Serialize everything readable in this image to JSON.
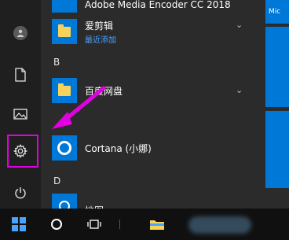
{
  "applist": {
    "items": [
      {
        "label": "Adobe Media Encoder CC 2018"
      },
      {
        "label": "爱剪辑",
        "sub": "最近添加"
      },
      {
        "letter": "B"
      },
      {
        "label": "百度网盘"
      },
      {
        "label": "Cortana (小娜)"
      },
      {
        "letter": "D"
      },
      {
        "label": "地图"
      }
    ]
  },
  "tiles": {
    "top_tile_text": "Mic"
  },
  "colors": {
    "accent": "#0078d7",
    "highlight": "#e100e1",
    "sub_label": "#4aa3ff"
  },
  "icons": {
    "rail": [
      "user-avatar-icon",
      "document-icon",
      "pictures-icon",
      "settings-gear-icon",
      "power-icon"
    ],
    "taskbar": [
      "windows-start-icon",
      "search-icon",
      "task-view-icon",
      "file-explorer-icon"
    ]
  }
}
